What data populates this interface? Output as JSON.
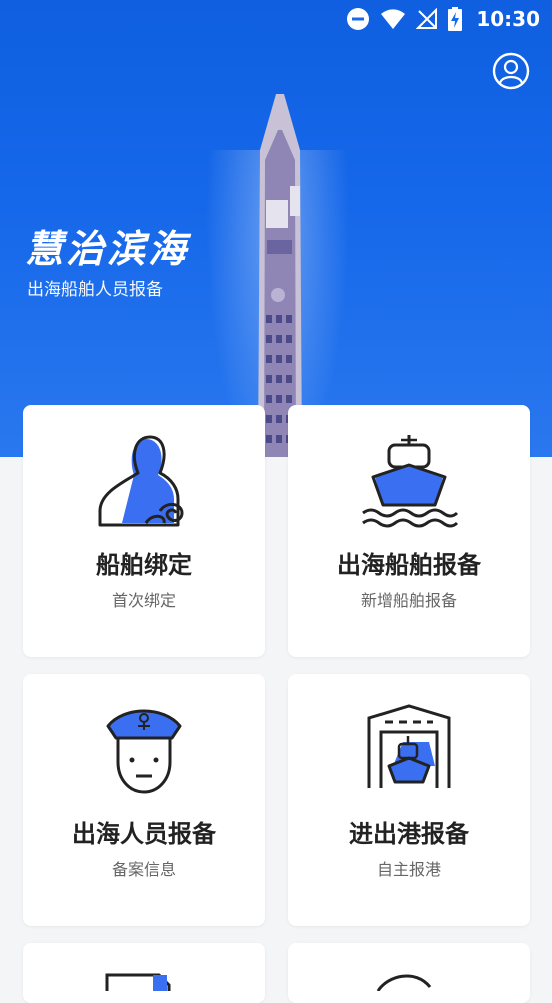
{
  "status_bar": {
    "time": "10:30"
  },
  "hero": {
    "title": "慧治滨海",
    "subtitle": "出海船舶人员报备"
  },
  "cards": [
    {
      "title": "船舶绑定",
      "subtitle": "首次绑定",
      "icon": "person-rope-icon"
    },
    {
      "title": "出海船舶报备",
      "subtitle": "新增船舶报备",
      "icon": "ship-waves-icon"
    },
    {
      "title": "出海人员报备",
      "subtitle": "备案信息",
      "icon": "sailor-icon"
    },
    {
      "title": "进出港报备",
      "subtitle": "自主报港",
      "icon": "harbor-ship-icon"
    }
  ],
  "colors": {
    "accent": "#2f6df0",
    "outline": "#222222"
  }
}
